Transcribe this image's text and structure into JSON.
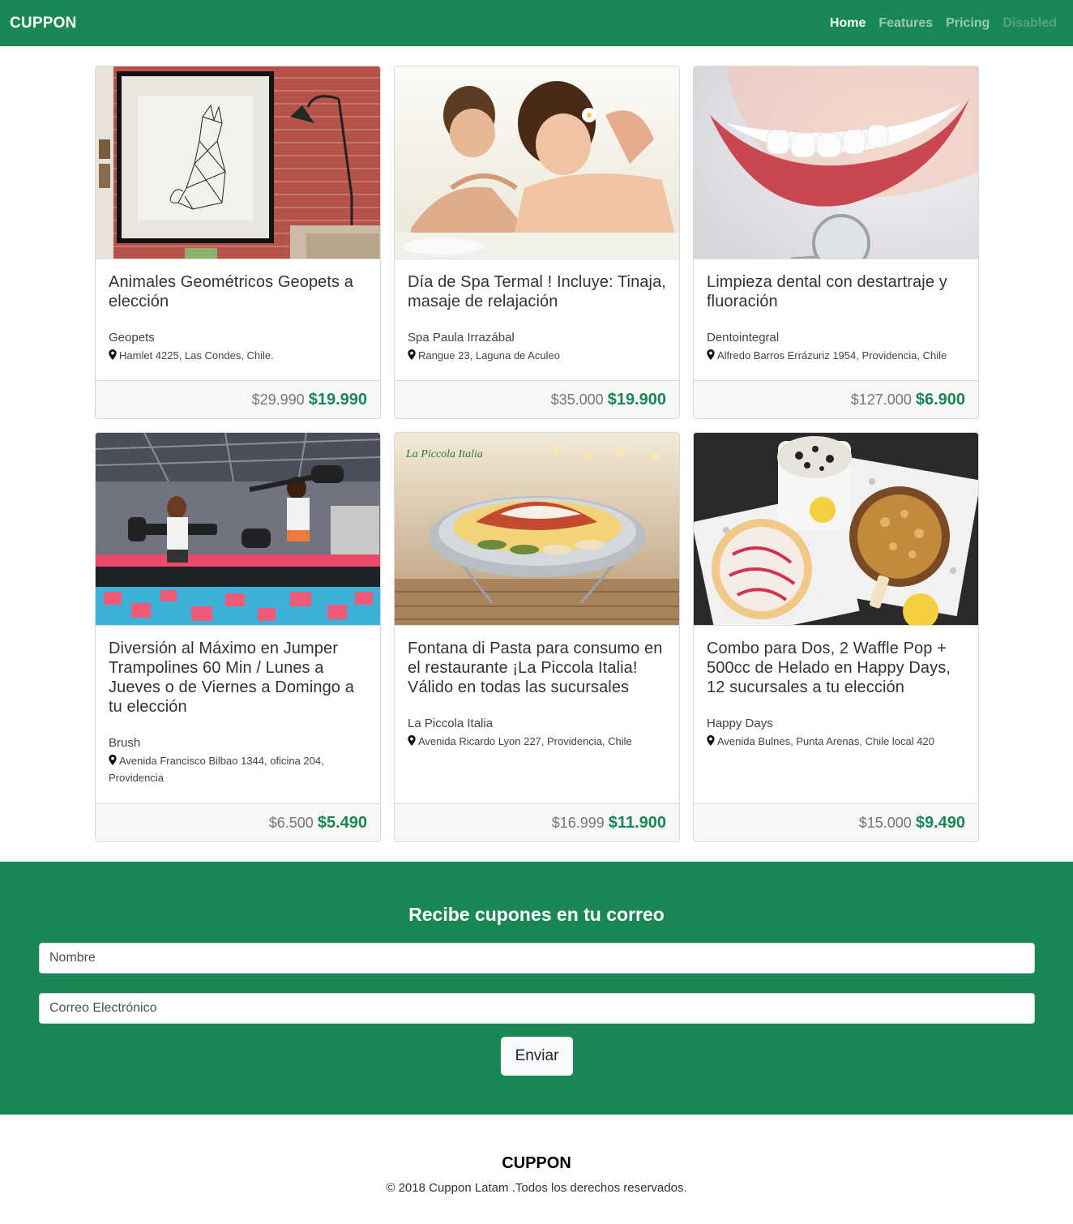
{
  "nav": {
    "brand": "CUPPON",
    "links": [
      {
        "label": "Home",
        "state": "active"
      },
      {
        "label": "Features",
        "state": "normal"
      },
      {
        "label": "Pricing",
        "state": "normal"
      },
      {
        "label": "Disabled",
        "state": "disabled"
      }
    ]
  },
  "deals": [
    {
      "title": "Animales Geométricos Geopets a elección",
      "merchant": "Geopets",
      "address": "Hamlet 4225, Las Condes, Chile.",
      "old_price": "$29.990",
      "price": "$19.990",
      "image": "cat-art-poster"
    },
    {
      "title": "Día de Spa Termal ! Incluye: Tinaja, masaje de relajación",
      "merchant": "Spa Paula Irrazábal",
      "address": "Rangue 23, Laguna de Aculeo",
      "old_price": "$35.000",
      "price": "$19.900",
      "image": "spa-couple-massage"
    },
    {
      "title": "Limpieza dental con destartraje y fluoración",
      "merchant": "Dentointegral",
      "address": "Alfredo Barros Errázuriz 1954, Providencia, Chile",
      "old_price": "$127.000",
      "price": "$6.900",
      "image": "dental-smile-mirror"
    },
    {
      "title": "Diversión al Máximo en Jumper Trampolines 60 Min / Lunes a Jueves o de Viernes a Domingo a tu elección",
      "merchant": "Brush",
      "address": "Avenida Francisco Bilbao 1344, oficina 204, Providencia",
      "old_price": "$6.500",
      "price": "$5.490",
      "image": "trampoline-park"
    },
    {
      "title": "Fontana di Pasta para consumo en el restaurante ¡La Piccola Italia! Válido en todas las sucursales",
      "merchant": "La Piccola Italia",
      "address": "Avenida Ricardo Lyon 227, Providencia, Chile",
      "old_price": "$16.999",
      "price": "$11.900",
      "image": "pasta-platter"
    },
    {
      "title": "Combo para Dos, 2 Waffle Pop + 500cc de Helado en Happy Days, 12 sucursales a tu elección",
      "merchant": "Happy Days",
      "address": "Avenida Bulnes, Punta Arenas, Chile local 420",
      "old_price": "$15.000",
      "price": "$9.490",
      "image": "waffle-pops"
    }
  ],
  "image_text": {
    "piccola_logo": "La Piccola Italia"
  },
  "subscribe": {
    "heading": "Recibe cupones en tu correo",
    "name_placeholder": "Nombre",
    "email_placeholder": "Correo Electrónico",
    "submit_label": "Enviar"
  },
  "footer": {
    "brand": "CUPPON",
    "copyright": "© 2018 Cuppon Latam .Todos los derechos reservados."
  },
  "colors": {
    "brand_green": "#1b8754",
    "price_green": "#1b8754"
  }
}
